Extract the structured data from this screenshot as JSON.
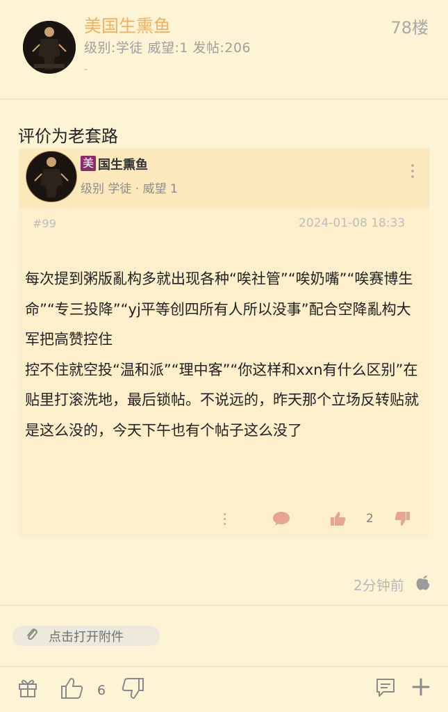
{
  "post": {
    "author": "美国生熏鱼",
    "floor": "78楼",
    "meta": "级别:学徒 威望:1 发帖:206",
    "dash": "-",
    "text": "评价为老套路",
    "time_ago": "2分钟前",
    "attachment_label": "点击打开附件"
  },
  "quote": {
    "badge": "美",
    "name": "国生熏鱼",
    "level": "级别 学徒 · 威望 1",
    "floor": "#99",
    "time": "2024-01-08 18:33",
    "body": "每次提到粥版亂构多就出现各种“唉社管”“唉奶嘴”“唉赛博生命”“专三投降”“yj平等创四所有人所以没事”配合空降亂构大军把高赞控住\n控不住就空投“温和派”“理中客”“你这样和xxn有什么区别”在贴里打滚洗地，最后锁帖。不说远的，昨天那个立场反转贴就是这么没的，今天下午也有个帖子这么没了",
    "like_count": "2"
  },
  "bottom": {
    "like_count": "6"
  },
  "colors": {
    "background": "#fdf4d5",
    "author_orange": "#f0b063",
    "badge_purple": "#8e2a69",
    "quote_bg": "#fdefcb",
    "comment_red": "#e6a593"
  }
}
